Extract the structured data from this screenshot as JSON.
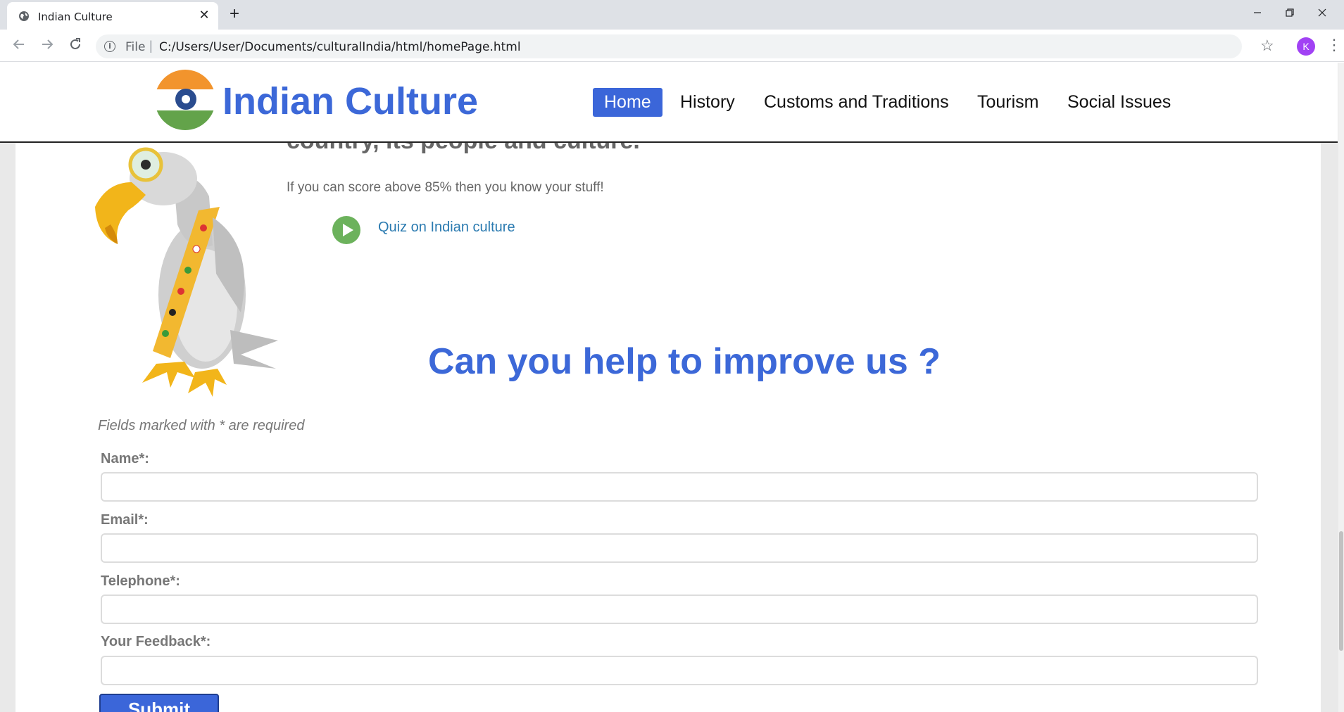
{
  "browser": {
    "tab_title": "Indian Culture",
    "tab_close": "✕",
    "new_tab": "+",
    "omnibox_scheme": "File",
    "omnibox_sep": "|",
    "url": "C:/Users/User/Documents/culturalIndia/html/homePage.html",
    "avatar_initial": "K",
    "icons": {
      "back": "arrow-left",
      "forward": "arrow-right",
      "reload": "reload",
      "info": "info",
      "star": "star",
      "menu": "three-dots"
    }
  },
  "site": {
    "title": "Indian Culture",
    "nav": [
      {
        "label": "Home",
        "active": true
      },
      {
        "label": "History",
        "active": false
      },
      {
        "label": "Customs and Traditions",
        "active": false
      },
      {
        "label": "Tourism",
        "active": false
      },
      {
        "label": "Social Issues",
        "active": false
      }
    ],
    "accent_color": "#3c68d8"
  },
  "quiz": {
    "partial_heading": "country, its people and culture.",
    "score_text": "If you can score above 85% then you know your stuff!",
    "link_label": "Quiz on Indian culture"
  },
  "feedback": {
    "heading": "Can you help to improve us ?",
    "required_note": "Fields marked with * are required",
    "fields": [
      {
        "label": "Name*:",
        "value": ""
      },
      {
        "label": "Email*:",
        "value": ""
      },
      {
        "label": "Telephone*:",
        "value": ""
      },
      {
        "label": "Your Feedback*:",
        "value": ""
      }
    ],
    "submit_label": "Submit"
  }
}
